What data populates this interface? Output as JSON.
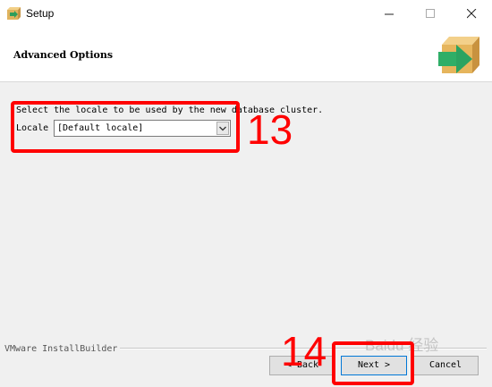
{
  "window": {
    "title": "Setup"
  },
  "header": {
    "title": "Advanced Options"
  },
  "main": {
    "instruction": "Select the locale to be used by the new database cluster.",
    "locale_label": "Locale",
    "locale_value": "[Default locale]"
  },
  "annotations": {
    "step_13": "13",
    "step_14": "14",
    "color": "#ff0000"
  },
  "footer": {
    "brand": "VMware InstallBuilder",
    "back_label": "< Back",
    "next_label": "Next >",
    "cancel_label": "Cancel"
  },
  "watermark": {
    "text": "Baidu 经验"
  }
}
